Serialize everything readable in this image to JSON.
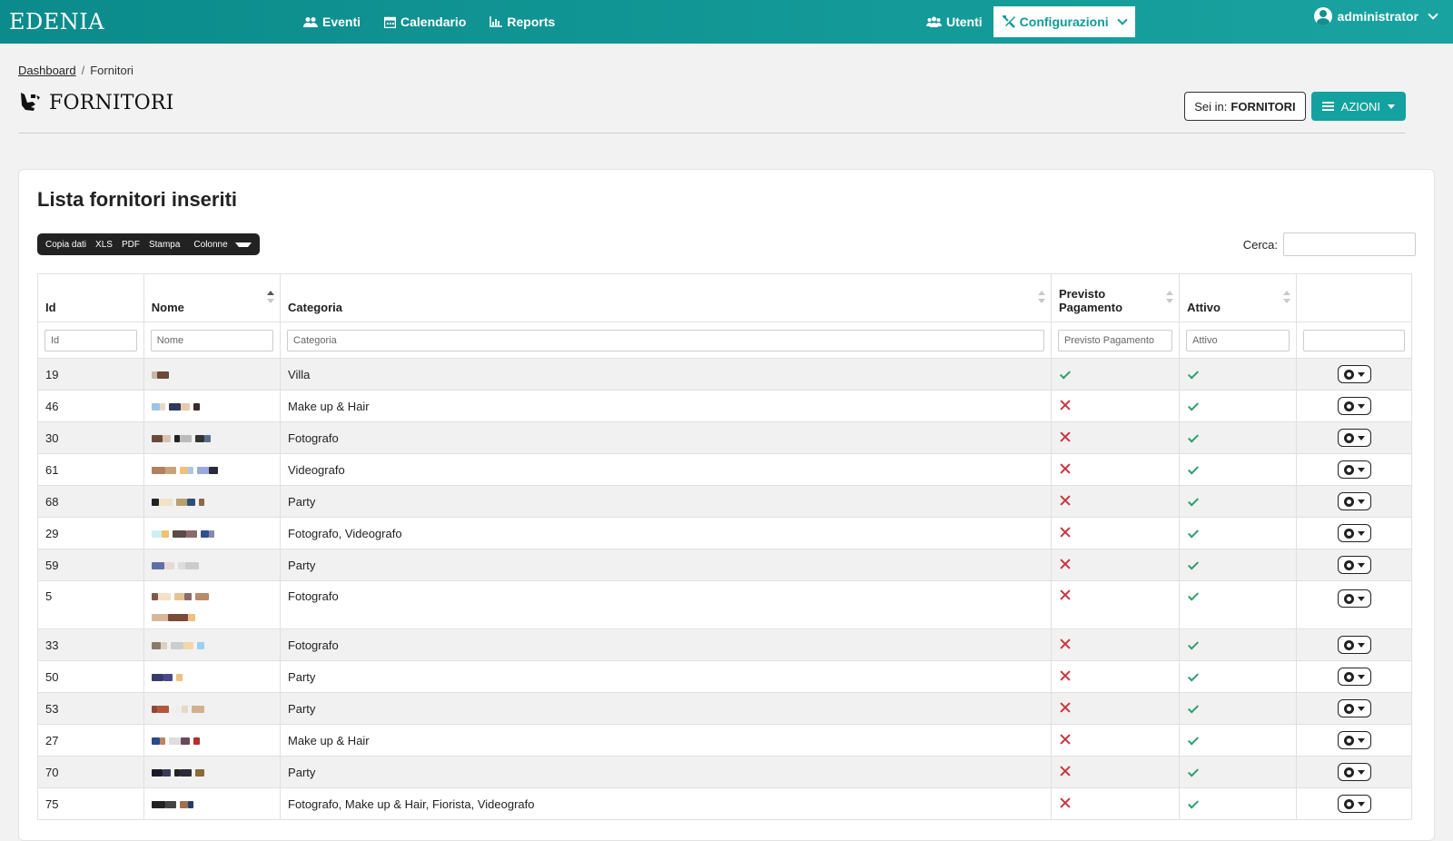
{
  "brand": "EDENIA",
  "nav": {
    "left": [
      {
        "label": "Eventi",
        "icon": "users-group-icon"
      },
      {
        "label": "Calendario",
        "icon": "calendar-icon"
      },
      {
        "label": "Reports",
        "icon": "chart-icon"
      }
    ],
    "right": [
      {
        "label": "Utenti",
        "icon": "users-icon"
      },
      {
        "label": "Configurazioni",
        "icon": "tools-icon",
        "active": true
      }
    ],
    "user": "administrator"
  },
  "breadcrumb": {
    "home": "Dashboard",
    "current": "Fornitori"
  },
  "page_title": "FORNITORI",
  "sei_in": {
    "prefix": "Sei in:",
    "value": "FORNITORI"
  },
  "azioni_label": "AZIONI",
  "card": {
    "title": "Lista fornitori inseriti",
    "buttons": [
      "Copia dati",
      "XLS",
      "PDF",
      "Stampa",
      "Colonne"
    ],
    "search_label": "Cerca:"
  },
  "table": {
    "headers": {
      "id": "Id",
      "nome": "Nome",
      "categoria": "Categoria",
      "previsto": "Previsto Pagamento",
      "attivo": "Attivo"
    },
    "filters": {
      "id": "Id",
      "nome": "Nome",
      "categoria": "Categoria",
      "previsto": "Previsto Pagamento",
      "attivo": "Attivo"
    },
    "rows": [
      {
        "id": "19",
        "categoria": "Villa",
        "previsto": true,
        "attivo": true
      },
      {
        "id": "46",
        "categoria": "Make up & Hair",
        "previsto": false,
        "attivo": true
      },
      {
        "id": "30",
        "categoria": "Fotografo",
        "previsto": false,
        "attivo": true
      },
      {
        "id": "61",
        "categoria": "Videografo",
        "previsto": false,
        "attivo": true
      },
      {
        "id": "68",
        "categoria": "Party",
        "previsto": false,
        "attivo": true
      },
      {
        "id": "29",
        "categoria": "Fotografo, Videografo",
        "previsto": false,
        "attivo": true
      },
      {
        "id": "59",
        "categoria": "Party",
        "previsto": false,
        "attivo": true
      },
      {
        "id": "5",
        "categoria": "Fotografo",
        "previsto": false,
        "attivo": true,
        "tall": true
      },
      {
        "id": "33",
        "categoria": "Fotografo",
        "previsto": false,
        "attivo": true
      },
      {
        "id": "50",
        "categoria": "Party",
        "previsto": false,
        "attivo": true
      },
      {
        "id": "53",
        "categoria": "Party",
        "previsto": false,
        "attivo": true
      },
      {
        "id": "27",
        "categoria": "Make up & Hair",
        "previsto": false,
        "attivo": true
      },
      {
        "id": "70",
        "categoria": "Party",
        "previsto": false,
        "attivo": true
      },
      {
        "id": "75",
        "categoria": "Fotografo, Make up & Hair, Fiorista, Videografo",
        "previsto": false,
        "attivo": true
      }
    ]
  },
  "colors": {
    "navbar": "#13a29f",
    "accent": "#13a29f",
    "check": "#2f9e6c",
    "cross": "#c9353d"
  }
}
